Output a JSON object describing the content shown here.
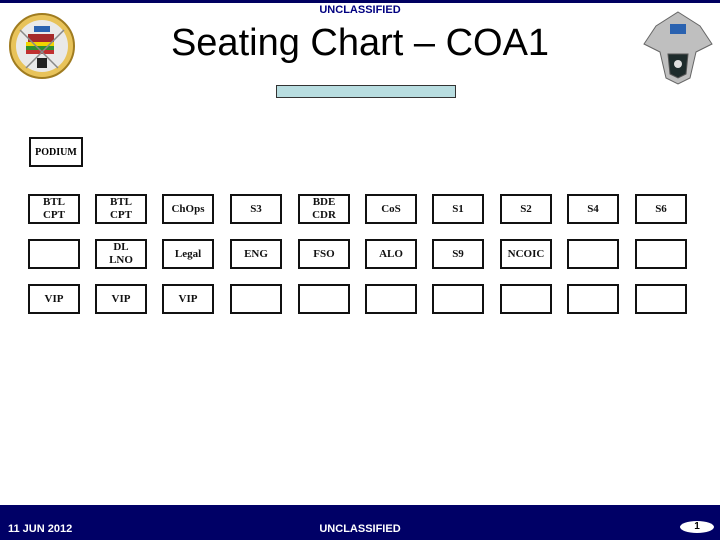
{
  "header": {
    "classification": "UNCLASSIFIED",
    "title": "Seating Chart – COA1",
    "logo_left": "unit-crest-icon",
    "logo_right": "eagle-crest-icon"
  },
  "podium": {
    "label": "PODIUM"
  },
  "rows": [
    {
      "seats": [
        "BTL\nCPT",
        "BTL\nCPT",
        "ChOps",
        "S3",
        "BDE\nCDR",
        "CoS",
        "S1",
        "S2",
        "S4",
        "S6"
      ]
    },
    {
      "seats": [
        "",
        "DL\nLNO",
        "Legal",
        "ENG",
        "FSO",
        "ALO",
        "S9",
        "NCOIC",
        "",
        ""
      ]
    },
    {
      "seats": [
        "VIP",
        "VIP",
        "VIP",
        "",
        "",
        "",
        "",
        "",
        "",
        ""
      ]
    }
  ],
  "footer": {
    "date": "11 JUN 2012",
    "classification": "UNCLASSIFIED",
    "page_number": "1"
  },
  "colors": {
    "navy": "#000066",
    "bar_fill": "#b8dde0"
  }
}
